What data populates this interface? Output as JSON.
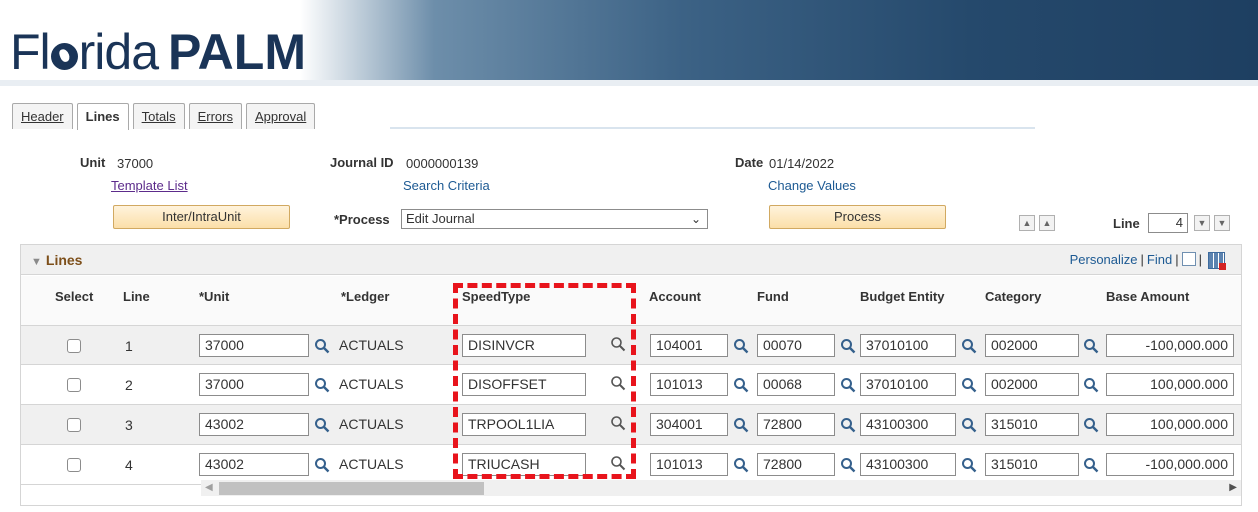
{
  "logo": {
    "light_left": "Fl",
    "light_right": "rida",
    "bold": "PALM"
  },
  "tabs": [
    {
      "label": "Header",
      "active": false
    },
    {
      "label": "Lines",
      "active": true
    },
    {
      "label": "Totals",
      "active": false
    },
    {
      "label": "Errors",
      "active": false
    },
    {
      "label": "Approval",
      "active": false
    }
  ],
  "header": {
    "unit_label": "Unit",
    "unit_value": "37000",
    "journal_id_label": "Journal ID",
    "journal_id_value": "0000000139",
    "date_label": "Date",
    "date_value": "01/14/2022",
    "template_list_link": "Template List",
    "search_criteria_link": "Search Criteria",
    "change_values_link": "Change Values",
    "inter_intra_button": "Inter/IntraUnit",
    "process_label": "*Process",
    "process_value": "Edit Journal",
    "process_button": "Process",
    "line_label": "Line",
    "line_value": "4"
  },
  "grid": {
    "title": "Lines",
    "personalize": "Personalize",
    "find": "Find",
    "columns": {
      "select": "Select",
      "line": "Line",
      "unit": "*Unit",
      "ledger": "*Ledger",
      "speedtype": "SpeedType",
      "account": "Account",
      "fund": "Fund",
      "budget_entity": "Budget Entity",
      "category": "Category",
      "base_amount": "Base Amount"
    },
    "rows": [
      {
        "line": "1",
        "unit": "37000",
        "ledger": "ACTUALS",
        "speedtype": "DISINVCR",
        "account": "104001",
        "fund": "00070",
        "budget_entity": "37010100",
        "category": "002000",
        "base_amount": "-100,000.000"
      },
      {
        "line": "2",
        "unit": "37000",
        "ledger": "ACTUALS",
        "speedtype": "DISOFFSET",
        "account": "101013",
        "fund": "00068",
        "budget_entity": "37010100",
        "category": "002000",
        "base_amount": "100,000.000"
      },
      {
        "line": "3",
        "unit": "43002",
        "ledger": "ACTUALS",
        "speedtype": "TRPOOL1LIA",
        "account": "304001",
        "fund": "72800",
        "budget_entity": "43100300",
        "category": "315010",
        "base_amount": "100,000.000"
      },
      {
        "line": "4",
        "unit": "43002",
        "ledger": "ACTUALS",
        "speedtype": "TRIUCASH",
        "account": "101013",
        "fund": "72800",
        "budget_entity": "43100300",
        "category": "315010",
        "base_amount": "-100,000.000"
      }
    ]
  },
  "colors": {
    "accent_link": "#1d5a93",
    "highlight": "#e8141c",
    "button": "#fbdfa9",
    "grid_title": "#7d4f1a"
  }
}
